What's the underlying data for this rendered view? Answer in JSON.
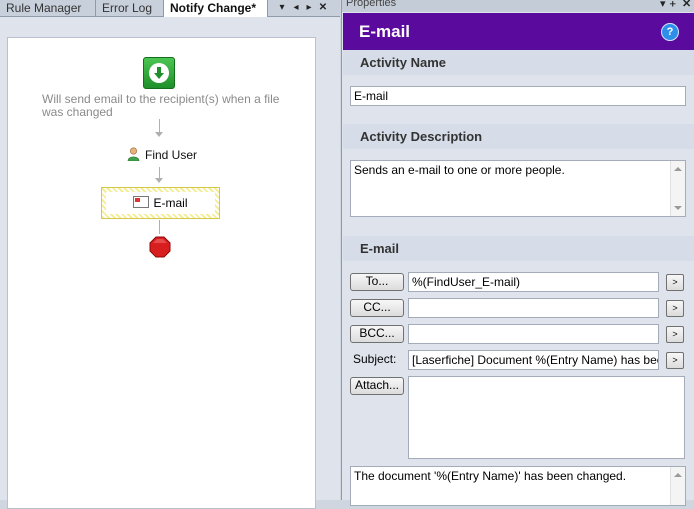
{
  "tabs": [
    {
      "label": "Rule Manager",
      "active": false
    },
    {
      "label": "Error Log",
      "active": false
    },
    {
      "label": "Notify Change*",
      "active": true
    }
  ],
  "tab_controls": {
    "pin": "▾",
    "prev": "◂",
    "next": "▸",
    "close": "✕"
  },
  "workflow": {
    "start_description": "Will send email to the recipient(s) when a file was changed",
    "find_user_label": "Find User",
    "email_label": "E-mail"
  },
  "properties": {
    "panel_title": "Properties",
    "panel_controls": {
      "menu": "▾",
      "pin": "ᚐ",
      "close": "✕"
    },
    "header_title": "E-mail",
    "help_glyph": "?",
    "activity_name_heading": "Activity Name",
    "activity_name_value": "E-mail",
    "activity_description_heading": "Activity Description",
    "activity_description_value": "Sends an e-mail to one or more people.",
    "email_heading": "E-mail",
    "to_button": "To...",
    "to_value": "%(FindUser_E-mail)",
    "cc_button": "CC...",
    "cc_value": "",
    "bcc_button": "BCC...",
    "bcc_value": "",
    "subject_label": "Subject:",
    "subject_value": "[Laserfiche] Document %(Entry Name) has been changed",
    "attach_button": "Attach...",
    "attach_value": "",
    "body_value": "The document '%(Entry Name)' has been changed.",
    "expand_glyph": ">"
  },
  "colors": {
    "header_bg": "#5a0a9c",
    "start_green": "#2aa535",
    "stop_red": "#d81e1e",
    "selection_yellow": "#f5ed97"
  },
  "icons": [
    "start-arrow-icon",
    "user-icon",
    "mail-icon",
    "stop-icon",
    "help-icon"
  ]
}
